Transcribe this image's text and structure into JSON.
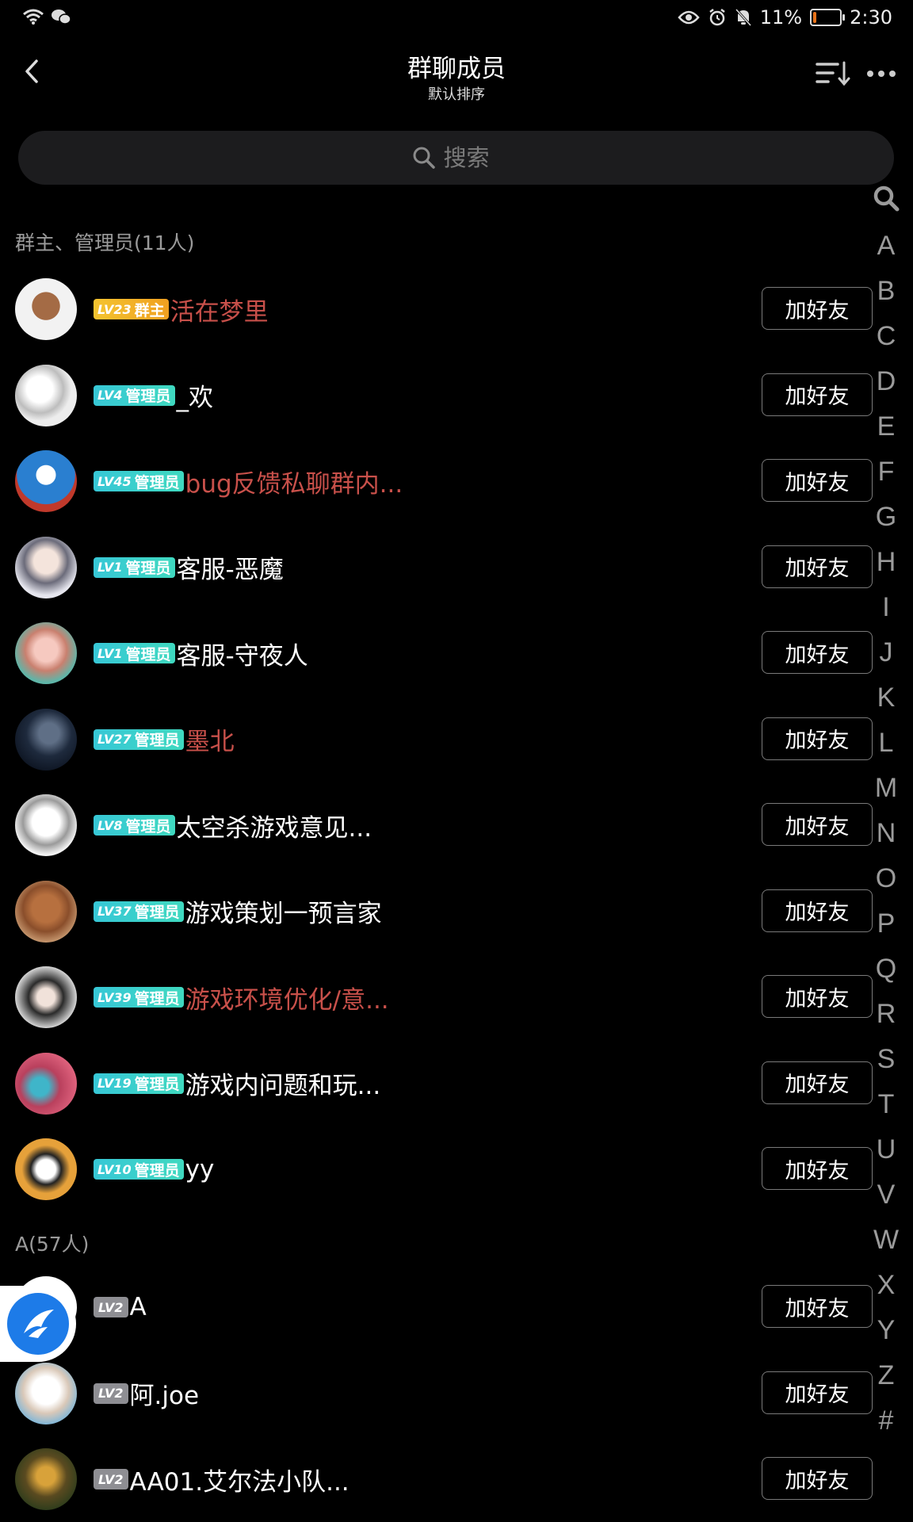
{
  "status_bar": {
    "battery_text": "11%",
    "time": "2:30",
    "battery_level": 0.11
  },
  "header": {
    "title": "群聊成员",
    "subtitle": "默认排序"
  },
  "search": {
    "placeholder": "搜索"
  },
  "sections": {
    "admins": {
      "title": "群主、管理员(11人)",
      "members": [
        {
          "level": "LV23",
          "role": "群主",
          "name": "活在梦里",
          "highlight": true
        },
        {
          "level": "LV4",
          "role": "管理员",
          "name": "_欢",
          "highlight": false
        },
        {
          "level": "LV45",
          "role": "管理员",
          "name": "bug反馈私聊群内...",
          "highlight": true
        },
        {
          "level": "LV1",
          "role": "管理员",
          "name": "客服-恶魔",
          "highlight": false
        },
        {
          "level": "LV1",
          "role": "管理员",
          "name": "客服-守夜人",
          "highlight": false
        },
        {
          "level": "LV27",
          "role": "管理员",
          "name": "墨北",
          "highlight": true
        },
        {
          "level": "LV8",
          "role": "管理员",
          "name": "太空杀游戏意见...",
          "highlight": false
        },
        {
          "level": "LV37",
          "role": "管理员",
          "name": "游戏策划一预言家",
          "highlight": false
        },
        {
          "level": "LV39",
          "role": "管理员",
          "name": "游戏环境优化/意...",
          "highlight": true
        },
        {
          "level": "LV19",
          "role": "管理员",
          "name": "游戏内问题和玩...",
          "highlight": false
        },
        {
          "level": "LV10",
          "role": "管理员",
          "name": "yy",
          "highlight": false
        }
      ]
    },
    "a_group": {
      "title": "A(57人)",
      "members": [
        {
          "level": "LV2",
          "role": "",
          "name": "A",
          "highlight": false
        },
        {
          "level": "LV2",
          "role": "",
          "name": "阿.joe",
          "highlight": false
        },
        {
          "level": "LV2",
          "role": "",
          "name": "AA01.艾尔法小队...",
          "highlight": false
        }
      ]
    }
  },
  "add_friend_label": "加好友",
  "index_letters": [
    "A",
    "B",
    "C",
    "D",
    "E",
    "F",
    "G",
    "H",
    "I",
    "J",
    "K",
    "L",
    "M",
    "N",
    "O",
    "P",
    "Q",
    "R",
    "S",
    "T",
    "U",
    "V",
    "W",
    "X",
    "Y",
    "Z",
    "#"
  ],
  "colors": {
    "background": "#000000",
    "highlight_name": "#c8504a",
    "owner_badge": "#f4c430",
    "admin_badge": "#3fd9c0"
  }
}
